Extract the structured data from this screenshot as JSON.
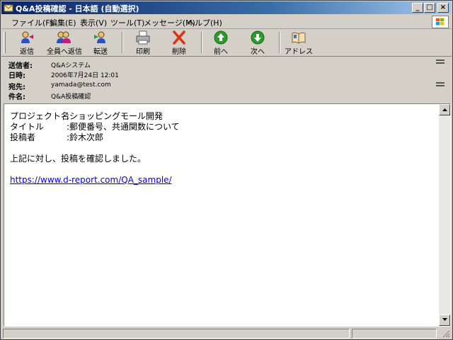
{
  "window": {
    "title": "Q&A投稿確認 - 日本語 (自動選択)",
    "controls": {
      "minimize": "_",
      "maximize": "□",
      "close": "×"
    }
  },
  "menu": [
    {
      "label": "ファイル(F)"
    },
    {
      "label": "編集(E)"
    },
    {
      "label": "表示(V)"
    },
    {
      "label": "ツール(T)"
    },
    {
      "label": "メッセージ(M)"
    },
    {
      "label": "ヘルプ(H)"
    }
  ],
  "toolbar": {
    "reply": "返信",
    "reply_all": "全員へ返信",
    "forward": "転送",
    "print": "印刷",
    "delete": "削除",
    "previous": "前へ",
    "next": "次へ",
    "addresses": "アドレス"
  },
  "header": {
    "from_label": "送信者:",
    "from_value": "Q&Aシステム",
    "date_label": "日時:",
    "date_value": "2006年7月24日 12:01",
    "to_label": "宛先:",
    "to_value": "yamada@test.com",
    "subject_label": "件名:",
    "subject_value": "Q&A投稿確認"
  },
  "message": {
    "project_label": "プロジェクト名",
    "project_value": ":ショッピングモール開発",
    "title_label": "タイトル",
    "title_value": ":郵便番号、共通関数について",
    "author_label": "投稿者",
    "author_value": ":鈴木次郎",
    "confirm_line": "上記に対し、投稿を確認しました。",
    "link": "https://www.d-report.com/QA_sample/"
  },
  "colors": {
    "titlebar_start": "#0a246a",
    "titlebar_end": "#a6caf0",
    "chrome": "#d4d0c8",
    "link": "#0000ee",
    "delete_icon": "#e03010",
    "nav_icon": "#2a9a2a"
  }
}
